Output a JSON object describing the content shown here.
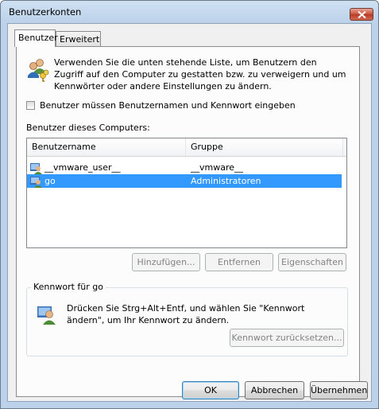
{
  "window": {
    "title": "Benutzerkonten"
  },
  "tabs": [
    {
      "label": "Benutzer",
      "active": true
    },
    {
      "label": "Erweitert",
      "active": false
    }
  ],
  "intro_text": "Verwenden Sie die unten stehende Liste, um Benutzern den Zugriff auf den Computer zu gestatten bzw. zu verweigern und um Kennwörter oder andere Einstellungen zu ändern.",
  "require_login": {
    "label": "Benutzer müssen Benutzernamen und Kennwort eingeben",
    "checked": false
  },
  "users_section": {
    "label": "Benutzer dieses Computers:"
  },
  "user_list": {
    "columns": [
      "Benutzername",
      "Gruppe"
    ],
    "rows": [
      {
        "name": "__vmware_user__",
        "group": "__vmware__",
        "selected": false
      },
      {
        "name": "go",
        "group": "Administratoren",
        "selected": true
      }
    ]
  },
  "list_buttons": {
    "add": "Hinzufügen...",
    "remove": "Entfernen",
    "properties": "Eigenschaften"
  },
  "password_group": {
    "title": "Kennwort für go",
    "text": "Drücken Sie Strg+Alt+Entf, und wählen Sie \"Kennwort ändern\", um Ihr Kennwort zu ändern.",
    "reset_button": "Kennwort zurücksetzen..."
  },
  "dialog_buttons": {
    "ok": "OK",
    "cancel": "Abbrechen",
    "apply": "Übernehmen"
  },
  "colors": {
    "selection": "#3399ff",
    "close_button": "#c9503a",
    "frame": "#bcd2ea"
  }
}
